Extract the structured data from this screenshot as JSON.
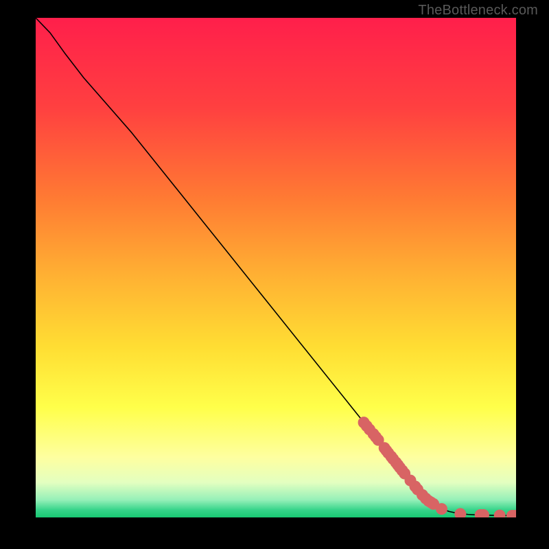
{
  "watermark": "TheBottleneck.com",
  "chart_data": {
    "type": "line",
    "title": "",
    "xlabel": "",
    "ylabel": "",
    "xlim": [
      0,
      100
    ],
    "ylim": [
      0,
      100
    ],
    "series": [
      {
        "name": "curve",
        "x": [
          0,
          3,
          6,
          10,
          15,
          20,
          25,
          30,
          35,
          40,
          45,
          50,
          55,
          60,
          65,
          70,
          72,
          75,
          78,
          80,
          82,
          84,
          86,
          88,
          90,
          92,
          94,
          96,
          98,
          100
        ],
        "y": [
          100,
          97,
          93,
          88,
          82.5,
          77,
          71,
          65,
          59,
          53,
          47,
          41,
          35,
          29,
          23,
          17,
          14.6,
          11,
          7.4,
          5,
          3.2,
          2.0,
          1.2,
          0.8,
          0.6,
          0.5,
          0.45,
          0.4,
          0.38,
          0.35
        ]
      }
    ],
    "markers": [
      {
        "x": 68.3,
        "y": 19.0
      },
      {
        "x": 68.9,
        "y": 18.3
      },
      {
        "x": 69.5,
        "y": 17.6
      },
      {
        "x": 70.3,
        "y": 16.7
      },
      {
        "x": 70.8,
        "y": 16.1
      },
      {
        "x": 71.3,
        "y": 15.5
      },
      {
        "x": 72.6,
        "y": 13.9
      },
      {
        "x": 73.0,
        "y": 13.4
      },
      {
        "x": 73.4,
        "y": 12.9
      },
      {
        "x": 74.0,
        "y": 12.2
      },
      {
        "x": 74.4,
        "y": 11.7
      },
      {
        "x": 75.0,
        "y": 11.0
      },
      {
        "x": 75.4,
        "y": 10.5
      },
      {
        "x": 75.8,
        "y": 10.0
      },
      {
        "x": 76.3,
        "y": 9.4
      },
      {
        "x": 76.8,
        "y": 8.8
      },
      {
        "x": 78.0,
        "y": 7.4
      },
      {
        "x": 79.0,
        "y": 6.2
      },
      {
        "x": 79.5,
        "y": 5.6
      },
      {
        "x": 80.5,
        "y": 4.5
      },
      {
        "x": 81.2,
        "y": 3.8
      },
      {
        "x": 81.8,
        "y": 3.3
      },
      {
        "x": 82.3,
        "y": 3.0
      },
      {
        "x": 82.8,
        "y": 2.7
      },
      {
        "x": 84.5,
        "y": 1.7
      },
      {
        "x": 88.4,
        "y": 0.7
      },
      {
        "x": 92.6,
        "y": 0.5
      },
      {
        "x": 93.2,
        "y": 0.5
      },
      {
        "x": 96.6,
        "y": 0.4
      },
      {
        "x": 99.2,
        "y": 0.35
      },
      {
        "x": 99.8,
        "y": 0.35
      }
    ],
    "gradient_stops": [
      {
        "pct": 0,
        "color": "#ff1f4b"
      },
      {
        "pct": 18,
        "color": "#ff4040"
      },
      {
        "pct": 36,
        "color": "#ff7a33"
      },
      {
        "pct": 52,
        "color": "#ffb233"
      },
      {
        "pct": 66,
        "color": "#ffde33"
      },
      {
        "pct": 78,
        "color": "#ffff4a"
      },
      {
        "pct": 88,
        "color": "#feffa0"
      },
      {
        "pct": 93,
        "color": "#e3ffc0"
      },
      {
        "pct": 96.5,
        "color": "#95f0b8"
      },
      {
        "pct": 98.5,
        "color": "#36d48a"
      },
      {
        "pct": 100,
        "color": "#18c873"
      }
    ],
    "marker_color": "#d86464",
    "line_color": "#000000"
  }
}
